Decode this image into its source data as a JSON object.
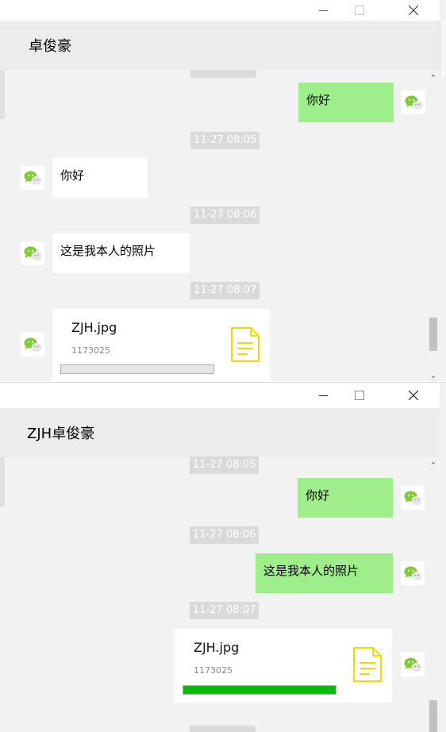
{
  "window_top": {
    "contact_name": "卓俊豪",
    "messages": [
      {
        "type": "text",
        "direction": "out",
        "text": "你好"
      },
      {
        "type": "timestamp",
        "text": "11-27 08:05"
      },
      {
        "type": "text",
        "direction": "in",
        "text": "你好"
      },
      {
        "type": "timestamp",
        "text": "11-27 08:06"
      },
      {
        "type": "text",
        "direction": "in",
        "text": "这是我本人的照片"
      },
      {
        "type": "timestamp",
        "text": "11-27 08:07"
      },
      {
        "type": "file",
        "direction": "in",
        "file_name": "ZJH.jpg",
        "file_size": "1173025",
        "progress": 0.0
      }
    ]
  },
  "window_bottom": {
    "contact_name": "ZJH卓俊豪",
    "messages": [
      {
        "type": "timestamp",
        "text": "11-27 08:05"
      },
      {
        "type": "text",
        "direction": "out",
        "text": "你好"
      },
      {
        "type": "timestamp",
        "text": "11-27 08:06"
      },
      {
        "type": "text",
        "direction": "out",
        "text": "这是我本人的照片"
      },
      {
        "type": "timestamp",
        "text": "11-27 08:07"
      },
      {
        "type": "file",
        "direction": "out",
        "file_name": "ZJH.jpg",
        "file_size": "1173025",
        "progress": 1.0
      }
    ]
  },
  "icons": {
    "avatar": "wechat-avatar-icon",
    "file": "document-file-icon",
    "minimize": "minimize-icon",
    "maximize": "maximize-icon",
    "close": "close-icon",
    "scroll_up": "chevron-up-icon",
    "scroll_down": "chevron-down-icon"
  },
  "colors": {
    "outgoing_bubble": "#9eef8b",
    "incoming_bubble": "#ffffff",
    "timestamp_bg": "#dadada",
    "progress_fill": "#09bb07",
    "file_icon": "#f4d800",
    "chat_bg": "#f2f2f2"
  }
}
